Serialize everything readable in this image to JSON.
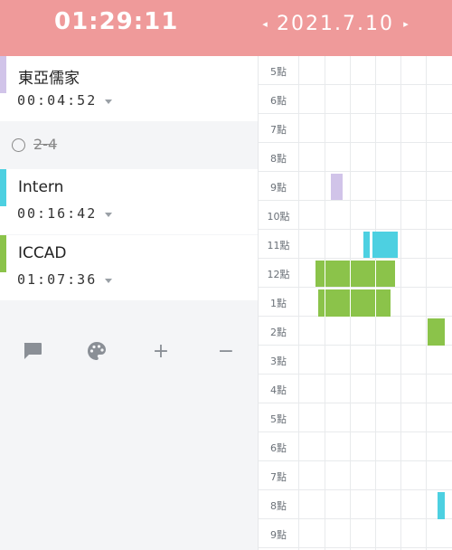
{
  "header": {
    "timer": "01:29:11",
    "date": "2021.7.10",
    "prev_icon": "◂",
    "next_icon": "▸"
  },
  "tasks": [
    {
      "name": "東亞儒家",
      "time": "00:04:52",
      "color": "#d1c4e9"
    },
    {
      "name": "Intern",
      "time": "00:16:42",
      "color": "#4dd0e1"
    },
    {
      "name": "ICCAD",
      "time": "01:07:36",
      "color": "#8bc34a"
    }
  ],
  "completed": {
    "label": "2-4"
  },
  "toolbar": {
    "comment_icon": "comment-icon",
    "palette_icon": "palette-icon",
    "add_symbol": "+",
    "remove_symbol": "−"
  },
  "timeline": {
    "hours": [
      "5點",
      "6點",
      "7點",
      "8點",
      "9點",
      "10點",
      "11點",
      "12點",
      "1點",
      "2點",
      "3點",
      "4點",
      "5點",
      "6點",
      "7點",
      "8點",
      "9點"
    ],
    "colors": {
      "purple": "#d1c4e9",
      "cyan": "#4dd0e1",
      "green": "#8bc34a"
    }
  }
}
